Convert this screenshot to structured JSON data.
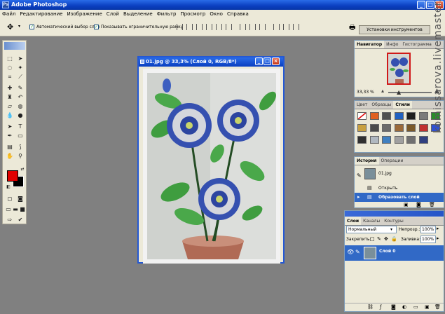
{
  "app": {
    "title": "Adobe Photoshop",
    "icon": "Ps"
  },
  "window_buttons": [
    "minimize-icon",
    "maximize-icon",
    "close-icon"
  ],
  "menu": [
    "Файл",
    "Редактирование",
    "Изображение",
    "Слой",
    "Выделение",
    "Фильтр",
    "Просмотр",
    "Окно",
    "Справка"
  ],
  "options": {
    "auto_select": "Автоматический выбор слоя",
    "show_bounds": "Показывать ограничительную рамку",
    "presets_label": "Установки инструментов"
  },
  "document": {
    "title": "01.jpg @ 33,3% (Слой 0, RGB/8*)"
  },
  "navigator": {
    "tabs": [
      "Навигатор",
      "Инфо",
      "Гистограмма"
    ],
    "zoom": "33,33 %"
  },
  "styles": {
    "tabs": [
      "Цвет",
      "Образцы",
      "Стили"
    ],
    "swatches": [
      "#f2f2f2",
      "#e06020",
      "#505050",
      "#2060c0",
      "#1e1e1e",
      "#7a7a7a",
      "#2a8c2a",
      "#c8a040",
      "#4a4a4a",
      "#6a6a6a",
      "#9a6a3a",
      "#7a5a2a",
      "#c03030",
      "#3050d0",
      "#303030",
      "#b0b8c0",
      "#4080c0",
      "#a0a0a0",
      "#707070",
      "#304080"
    ]
  },
  "history": {
    "tabs": [
      "История",
      "Операции"
    ],
    "snapshot": "01.jpg",
    "items": [
      "Открыть",
      "Образовать слой"
    ]
  },
  "layers": {
    "tabs": [
      "Слои",
      "Каналы",
      "Контуры"
    ],
    "blend_mode": "Нормальный",
    "opacity_label": "Непрозр.:",
    "opacity": "100%",
    "lock_label": "Закрепить:",
    "fill_label": "Заливка:",
    "fill": "100%",
    "layer_name": "Слой 0"
  },
  "watermark": "komissarova.livemaster.ru"
}
